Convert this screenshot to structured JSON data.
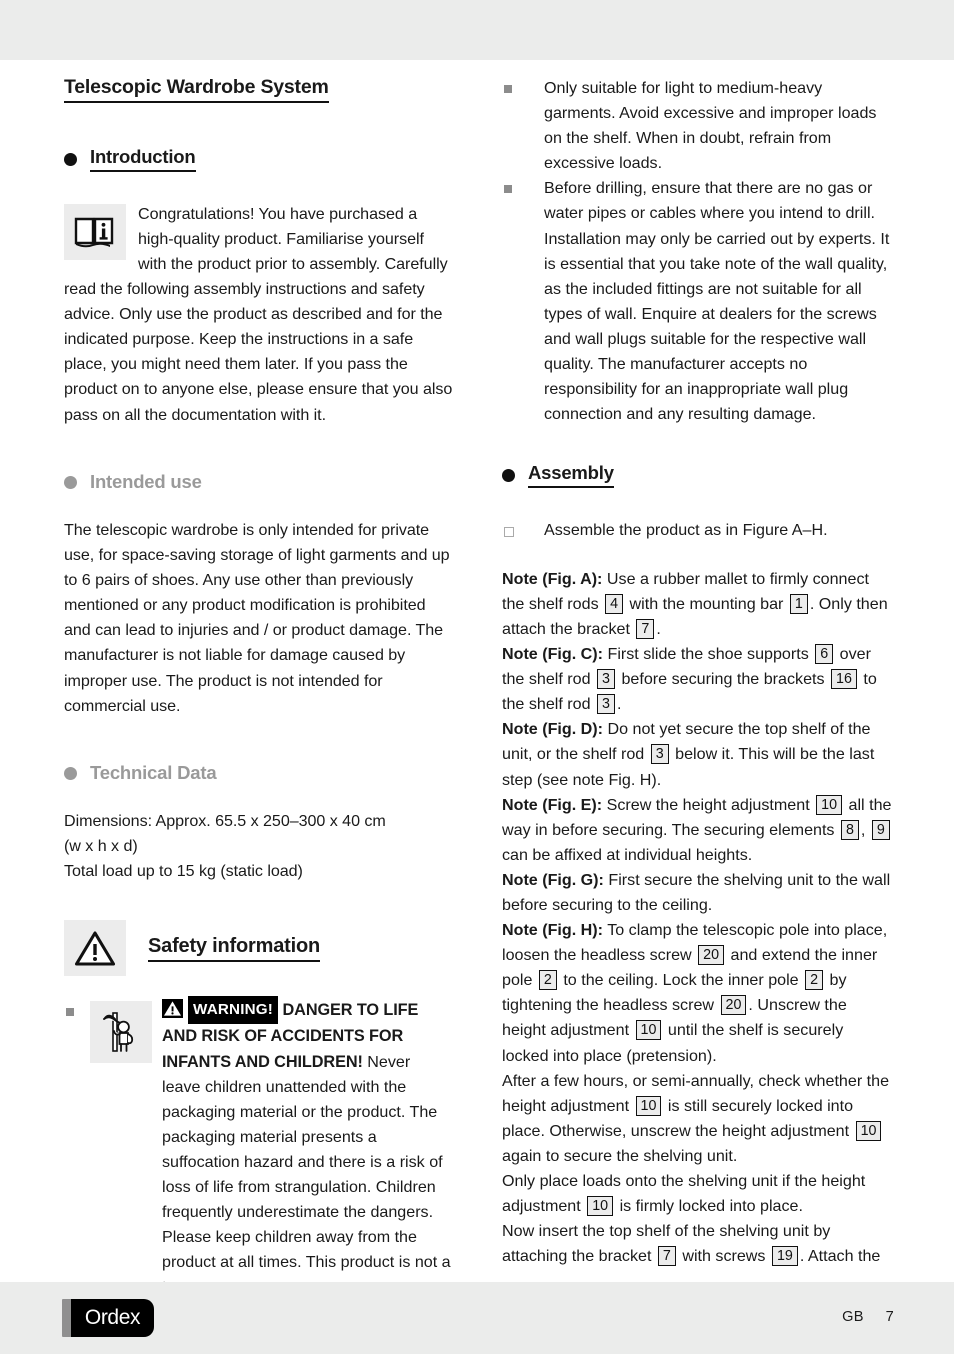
{
  "document": {
    "title": "Telescopic Wardrobe System",
    "brand": "Ordex",
    "language_code": "GB",
    "page_number": "7"
  },
  "left_column": {
    "introduction": {
      "heading": "Introduction",
      "icon": "open-book-info-icon",
      "body": "Congratulations! You have purchased a high-quality product. Familiarise yourself with the product prior to assembly. Carefully read the following assembly instructions and safety advice. Only use the product as described and for the indicated purpose. Keep the instructions in a safe place, you might need them later. If you pass the product on to anyone else, please ensure that you also pass on all the documentation with it."
    },
    "intended_use": {
      "heading": "Intended use",
      "body": "The telescopic wardrobe is only intended for private use, for space-saving storage of light garments and up to 6 pairs of shoes. Any use other than previously mentioned or any product modification is prohibited and can lead to injuries and / or product damage. The manufacturer is not liable for damage caused by improper use. The product is not intended for commercial use."
    },
    "technical_data": {
      "heading": "Technical Data",
      "lines": [
        "Dimensions: Approx. 65.5 x 250–300 x 40 cm",
        "(w x h x d)",
        "Total load up to 15 kg (static load)"
      ]
    },
    "safety": {
      "heading": "Safety information",
      "icon": "warning-triangle-icon",
      "warning_icon": "child-reaching-hazard-icon",
      "badge_label": "WARNING!",
      "danger_headline": "DANGER TO LIFE AND RISK OF ACCIDENTS FOR INFANTS AND CHILDREN!",
      "body": "Never leave children unattended with the packaging material or the product. The packaging material presents a suffocation hazard and there is a risk of loss of life from strangulation. Children frequently underestimate the dangers. Please keep children away from the product at all times. This product is not a toy."
    }
  },
  "right_column": {
    "safety_bullets": [
      "Only suitable for light to medium-heavy garments. Avoid excessive and improper loads on the shelf. When in doubt, refrain from excessive loads.",
      "Before drilling, ensure that there are no gas or water pipes or cables where you intend to drill. Installation may only be carried out by experts. It is essential that you take note of the wall quality, as the included fittings are not suitable for all types of wall. Enquire at dealers for the screws and wall plugs suitable for the respective wall quality. The manufacturer accepts no responsibility for an inappropriate wall plug connection and any resulting damage."
    ],
    "assembly": {
      "heading": "Assembly",
      "bullet": "Assemble the product as in Figure A–H.",
      "notes": [
        {
          "label": "Note (Fig. A):",
          "parts": [
            {
              "t": "text",
              "v": " Use a rubber mallet to firmly connect the shelf rods "
            },
            {
              "t": "ref",
              "v": "4"
            },
            {
              "t": "text",
              "v": " with the mounting bar "
            },
            {
              "t": "ref",
              "v": "1"
            },
            {
              "t": "text",
              "v": ". Only then attach the bracket "
            },
            {
              "t": "ref",
              "v": "7"
            },
            {
              "t": "text",
              "v": "."
            }
          ]
        },
        {
          "label": "Note (Fig. C):",
          "parts": [
            {
              "t": "text",
              "v": " First slide the shoe supports "
            },
            {
              "t": "ref",
              "v": "6"
            },
            {
              "t": "text",
              "v": " over the shelf rod "
            },
            {
              "t": "ref",
              "v": "3"
            },
            {
              "t": "text",
              "v": " before securing the brackets "
            },
            {
              "t": "ref",
              "v": "16"
            },
            {
              "t": "text",
              "v": " to the shelf rod "
            },
            {
              "t": "ref",
              "v": "3"
            },
            {
              "t": "text",
              "v": "."
            }
          ]
        },
        {
          "label": "Note (Fig. D):",
          "parts": [
            {
              "t": "text",
              "v": " Do not yet secure the top shelf of the unit, or the shelf rod "
            },
            {
              "t": "ref",
              "v": "3"
            },
            {
              "t": "text",
              "v": " below it. This will be the last step (see note Fig. H)."
            }
          ]
        },
        {
          "label": "Note (Fig. E):",
          "parts": [
            {
              "t": "text",
              "v": " Screw the height adjustment "
            },
            {
              "t": "ref",
              "v": "10"
            },
            {
              "t": "text",
              "v": " all the way in before securing. The securing elements "
            },
            {
              "t": "ref",
              "v": "8"
            },
            {
              "t": "text",
              "v": ", "
            },
            {
              "t": "ref",
              "v": "9"
            },
            {
              "t": "text",
              "v": " can be affixed at individual heights."
            }
          ]
        },
        {
          "label": "Note (Fig. G):",
          "parts": [
            {
              "t": "text",
              "v": " First secure the shelving unit to the wall before securing to the ceiling."
            }
          ]
        },
        {
          "label": "Note (Fig. H):",
          "parts": [
            {
              "t": "text",
              "v": " To clamp the telescopic pole into place, loosen the headless screw "
            },
            {
              "t": "ref",
              "v": "20"
            },
            {
              "t": "text",
              "v": " and extend the inner pole "
            },
            {
              "t": "ref",
              "v": "2"
            },
            {
              "t": "text",
              "v": " to the ceiling. Lock the inner pole "
            },
            {
              "t": "ref",
              "v": "2"
            },
            {
              "t": "text",
              "v": " by tightening the headless screw "
            },
            {
              "t": "ref",
              "v": "20"
            },
            {
              "t": "text",
              "v": ". Unscrew the height adjustment "
            },
            {
              "t": "ref",
              "v": "10"
            },
            {
              "t": "text",
              "v": " until the shelf is securely locked into place (pretension)."
            }
          ]
        },
        {
          "label": "",
          "parts": [
            {
              "t": "text",
              "v": "After a few hours, or semi-annually, check whether the height adjustment "
            },
            {
              "t": "ref",
              "v": "10"
            },
            {
              "t": "text",
              "v": " is still securely locked into place. Otherwise, unscrew the height adjustment "
            },
            {
              "t": "ref",
              "v": "10"
            },
            {
              "t": "text",
              "v": " again to secure the shelving unit."
            }
          ]
        },
        {
          "label": "",
          "parts": [
            {
              "t": "text",
              "v": "Only place loads onto the shelving unit if the height adjustment "
            },
            {
              "t": "ref",
              "v": "10"
            },
            {
              "t": "text",
              "v": " is firmly locked into place."
            }
          ]
        },
        {
          "label": "",
          "parts": [
            {
              "t": "text",
              "v": "Now insert the top shelf of the shelving unit by attaching the bracket "
            },
            {
              "t": "ref",
              "v": "7"
            },
            {
              "t": "text",
              "v": " with screws "
            },
            {
              "t": "ref",
              "v": "19"
            },
            {
              "t": "text",
              "v": ". Attach the"
            }
          ]
        }
      ]
    }
  },
  "colors": {
    "band": "#ebeceb",
    "icon_box": "#ececec",
    "grey_heading": "#9a9a9a",
    "bullet": "#8c8c8c",
    "text": "#1a1a1a"
  }
}
